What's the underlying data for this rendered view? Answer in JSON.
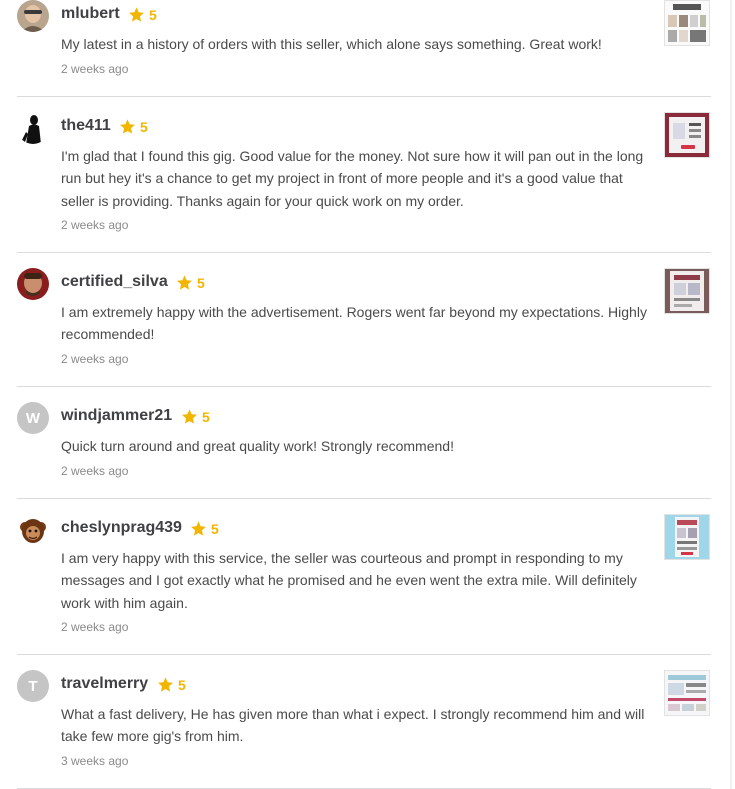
{
  "reviews": [
    {
      "username": "mlubert",
      "rating": "5",
      "text": "My latest in a history of orders with this seller, which alone says something. Great work!",
      "time": "2 weeks ago",
      "avatar_letter": ""
    },
    {
      "username": "the411",
      "rating": "5",
      "text": "I'm glad that I found this gig. Good value for the money. Not sure how it will pan out in the long run but hey it's a chance to get my project in front of more people and it's a good value that seller is providing. Thanks again for your quick work on my order.",
      "time": "2 weeks ago",
      "avatar_letter": ""
    },
    {
      "username": "certified_silva",
      "rating": "5",
      "text": "I am extremely happy with the advertisement. Rogers went far beyond my expectations. Highly recommended!",
      "time": "2 weeks ago",
      "avatar_letter": ""
    },
    {
      "username": "windjammer21",
      "rating": "5",
      "text": "Quick turn around and great quality work! Strongly recommend!",
      "time": "2 weeks ago",
      "avatar_letter": "W"
    },
    {
      "username": "cheslynprag439",
      "rating": "5",
      "text": "I am very happy with this service, the seller was courteous and prompt in responding to my messages and I got exactly what he promised and he even went the extra mile. Will definitely work with him again.",
      "time": "2 weeks ago",
      "avatar_letter": ""
    },
    {
      "username": "travelmerry",
      "rating": "5",
      "text": "What a fast delivery, He has given more than what i expect. I strongly recommend him and will take few more gig's from him.",
      "time": "3 weeks ago",
      "avatar_letter": "T"
    }
  ],
  "colors": {
    "star": "#f2b500",
    "username": "#404145",
    "text": "#4a4a4a",
    "time": "#8a8a8a",
    "divider": "#dadbdd"
  },
  "icons": {
    "rating": "star-icon"
  }
}
